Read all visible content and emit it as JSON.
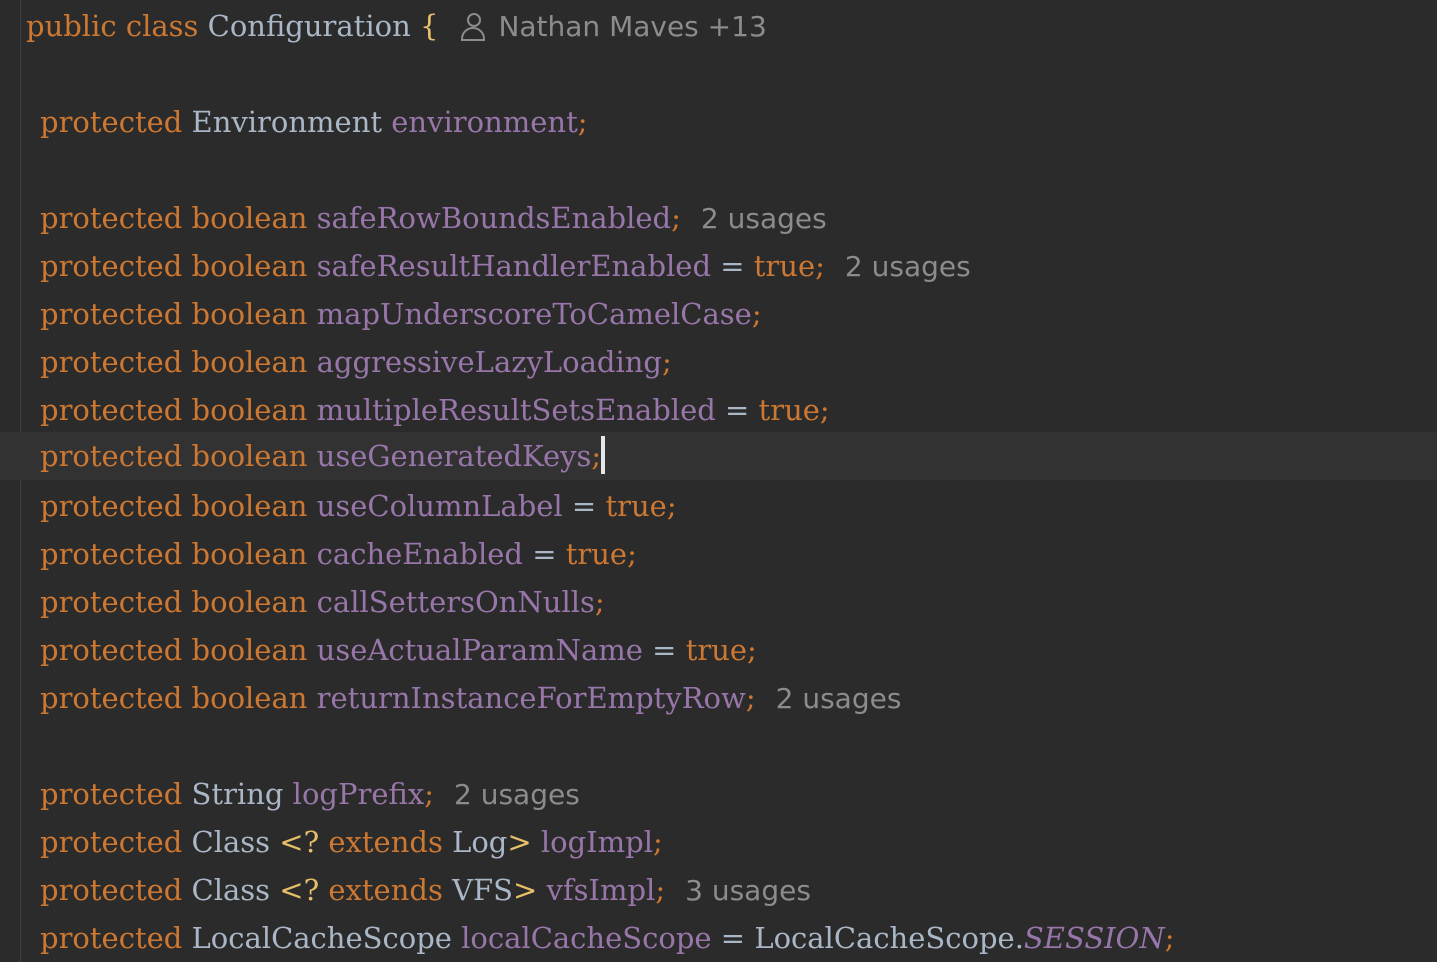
{
  "colors": {
    "background": "#2b2b2b",
    "keyword": "#cc7832",
    "field": "#9876aa",
    "text": "#a9b7c6",
    "hint": "#8c8c8c",
    "brace": "#e8bf6a",
    "caret_line": "#323232"
  },
  "header": {
    "kw_public": "public",
    "kw_class": "class",
    "class_name": "Configuration",
    "open_brace": "{",
    "author_icon": "person-icon",
    "author": "Nathan Maves +13"
  },
  "kw": {
    "protected": "protected",
    "boolean": "boolean",
    "true": "true",
    "extends": "extends",
    "eq": "=",
    "semi": ";",
    "wildcard_open": "<?",
    "close_angle": ">",
    "dot": "."
  },
  "lines": {
    "env": {
      "type": "Environment",
      "field": "environment"
    },
    "b1": {
      "field": "safeRowBoundsEnabled",
      "hint": "2 usages"
    },
    "b2": {
      "field": "safeResultHandlerEnabled",
      "hint": "2 usages"
    },
    "b3": {
      "field": "mapUnderscoreToCamelCase"
    },
    "b4": {
      "field": "aggressiveLazyLoading"
    },
    "b5": {
      "field": "multipleResultSetsEnabled"
    },
    "b6": {
      "field": "useGeneratedKeys"
    },
    "b7": {
      "field": "useColumnLabel"
    },
    "b8": {
      "field": "cacheEnabled"
    },
    "b9": {
      "field": "callSettersOnNulls"
    },
    "b10": {
      "field": "useActualParamName"
    },
    "b11": {
      "field": "returnInstanceForEmptyRow",
      "hint": "2 usages"
    },
    "s1": {
      "type": "String",
      "field": "logPrefix",
      "hint": "2 usages"
    },
    "c1": {
      "type": "Class",
      "generic": "Log",
      "field": "logImpl"
    },
    "c2": {
      "type": "Class",
      "generic": "VFS",
      "field": "vfsImpl",
      "hint": "3 usages"
    },
    "l1": {
      "type": "LocalCacheScope",
      "field": "localCacheScope",
      "value_type": "LocalCacheScope",
      "value_const": "SESSION"
    }
  }
}
